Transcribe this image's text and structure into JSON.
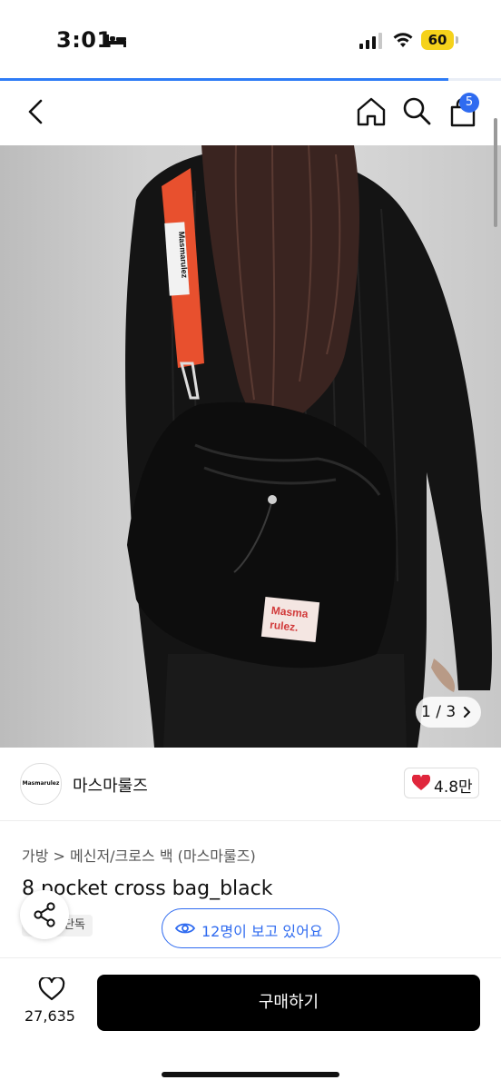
{
  "status": {
    "time": "3:01",
    "battery": "60"
  },
  "nav": {
    "cart_count": "5"
  },
  "hero": {
    "image_counter": "1 / 3",
    "strap_text": "Masmarulez",
    "bag_label_line1": "Masma",
    "bag_label_line2": "rulez."
  },
  "seller": {
    "logo_text": "Masmarulez",
    "name": "마스마룰즈",
    "likes": "4.8만"
  },
  "product": {
    "breadcrumb": "가방 > 메신저/크로스 백 (마스마룰즈)",
    "title": "8 pocket cross bag_black",
    "tag": "단독",
    "viewers": "12명이 보고 있어요"
  },
  "bottom": {
    "wish_count": "27,635",
    "buy_label": "구매하기"
  },
  "colors": {
    "accent": "#2f6bf0",
    "heart": "#e0263c",
    "strap": "#e8502e"
  }
}
